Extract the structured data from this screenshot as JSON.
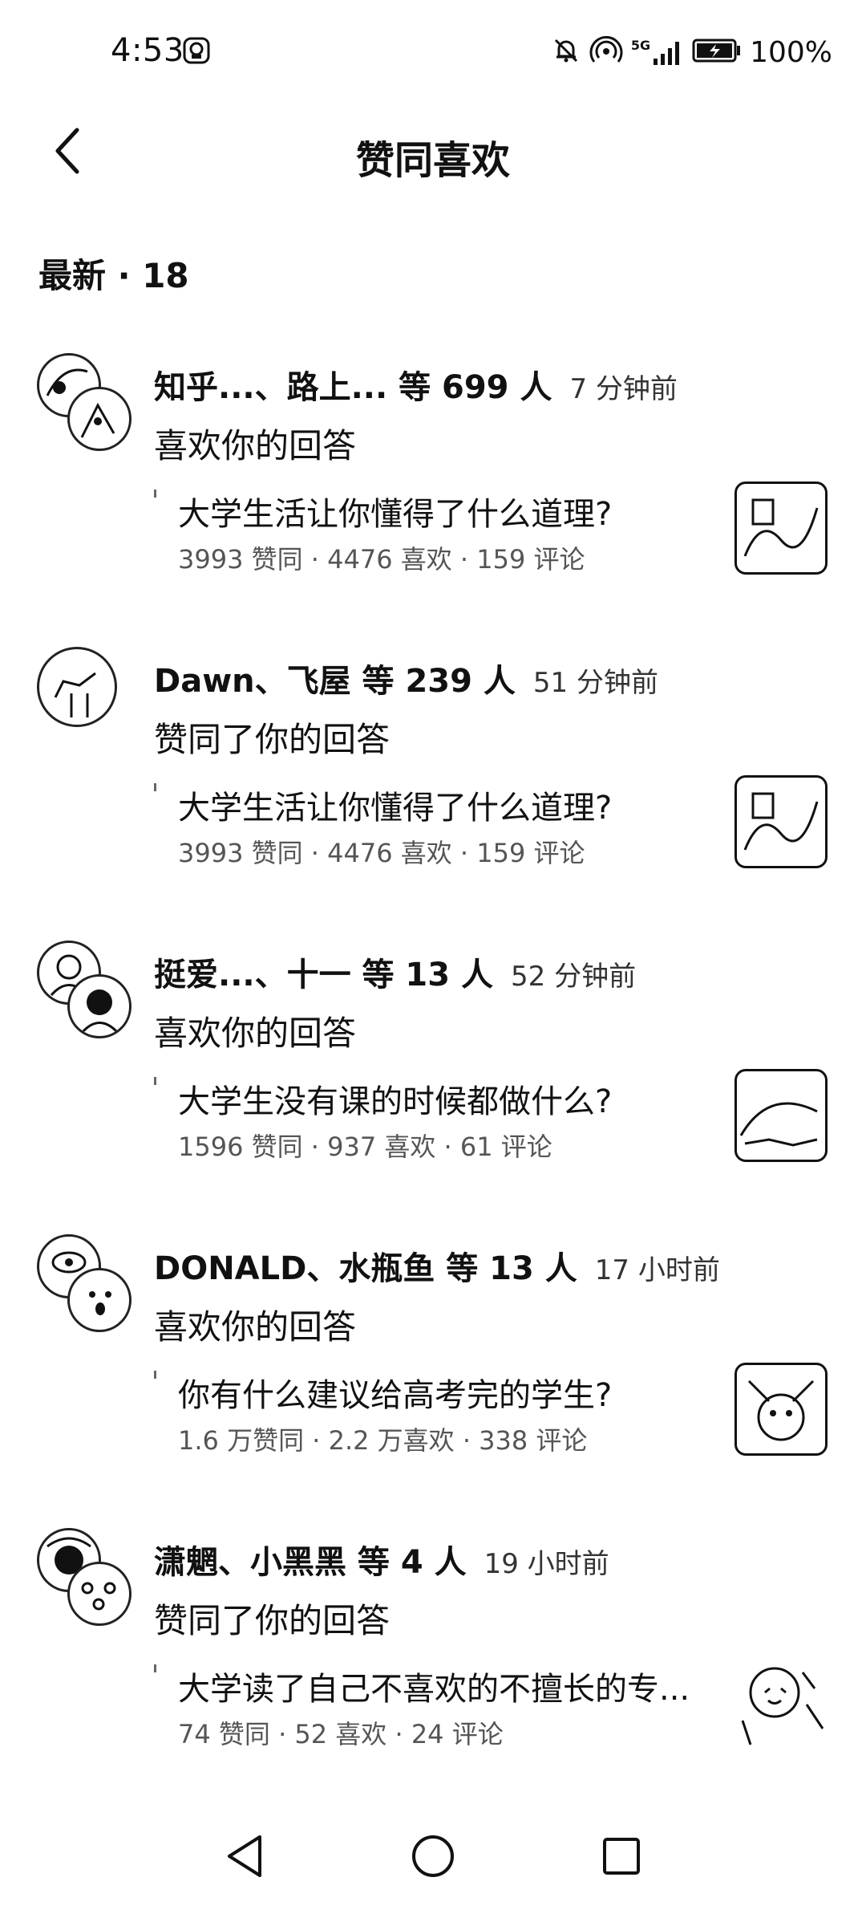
{
  "status_bar": {
    "time": "4:53",
    "left_icon": "app-notification-icon",
    "right_icons": [
      "mute-icon",
      "hotspot-icon",
      "signal-5g-icon",
      "battery-icon"
    ],
    "signal_label": "5G",
    "battery_text": "100%"
  },
  "header": {
    "back_icon": "chevron-left-icon",
    "title": "赞同喜欢"
  },
  "section": {
    "label": "最新 · 18"
  },
  "notifications": [
    {
      "users": "知乎...、路上... 等 699 人",
      "time": "7 分钟前",
      "action": "喜欢你的回答",
      "question": "大学生活让你懂得了什么道理?",
      "stats": "3993 赞同 · 4476 喜欢 · 159 评论"
    },
    {
      "users": "Dawn、飞屋 等 239 人",
      "time": "51 分钟前",
      "action": "赞同了你的回答",
      "question": "大学生活让你懂得了什么道理?",
      "stats": "3993 赞同 · 4476 喜欢 · 159 评论"
    },
    {
      "users": "挺爱...、十一 等 13 人",
      "time": "52 分钟前",
      "action": "喜欢你的回答",
      "question": "大学生没有课的时候都做什么?",
      "stats": "1596 赞同 · 937 喜欢 · 61 评论"
    },
    {
      "users": "DONALD、水瓶鱼 等 13 人",
      "time": "17 小时前",
      "action": "喜欢你的回答",
      "question": "你有什么建议给高考完的学生?",
      "stats": "1.6 万赞同 · 2.2 万喜欢 · 338 评论"
    },
    {
      "users": "潇魍、小黑黑 等 4 人",
      "time": "19 小时前",
      "action": "赞同了你的回答",
      "question": "大学读了自己不喜欢的不擅长的专...",
      "stats": "74 赞同 · 52 喜欢 · 24 评论"
    }
  ],
  "nav_bar": {
    "icons": [
      "nav-back-icon",
      "nav-home-icon",
      "nav-recent-icon"
    ]
  },
  "colors": {
    "background": "#ffffff",
    "text": "#111111",
    "secondary_text": "#555555"
  }
}
